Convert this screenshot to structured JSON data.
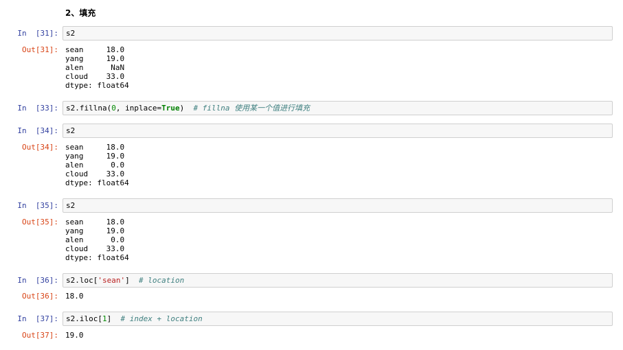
{
  "heading": "2、填充",
  "cells": [
    {
      "in_prompt": "In  [31]:",
      "code": "s2",
      "out_prompt": "Out[31]:",
      "output": "sean     18.0\nyang     19.0\nalen      NaN\ncloud    33.0\ndtype: float64"
    },
    {
      "in_prompt": "In  [33]:",
      "code_parts": [
        "s2.fillna(",
        "0",
        ", inplace=",
        "True",
        ")  ",
        "# fillna 使用某一个值进行填充"
      ]
    },
    {
      "in_prompt": "In  [34]:",
      "code": "s2",
      "out_prompt": "Out[34]:",
      "output": "sean     18.0\nyang     19.0\nalen      0.0\ncloud    33.0\ndtype: float64"
    },
    {
      "in_prompt": "In  [35]:",
      "code": "s2",
      "out_prompt": "Out[35]:",
      "output": "sean     18.0\nyang     19.0\nalen      0.0\ncloud    33.0\ndtype: float64"
    },
    {
      "in_prompt": "In  [36]:",
      "code_parts": [
        "s2.loc[",
        "'sean'",
        "]  ",
        "# location"
      ],
      "out_prompt": "Out[36]:",
      "output": "18.0"
    },
    {
      "in_prompt": "In  [37]:",
      "code_parts": [
        "s2.iloc[",
        "1",
        "]  ",
        "# index + location"
      ],
      "out_prompt": "Out[37]:",
      "output": "19.0"
    }
  ]
}
